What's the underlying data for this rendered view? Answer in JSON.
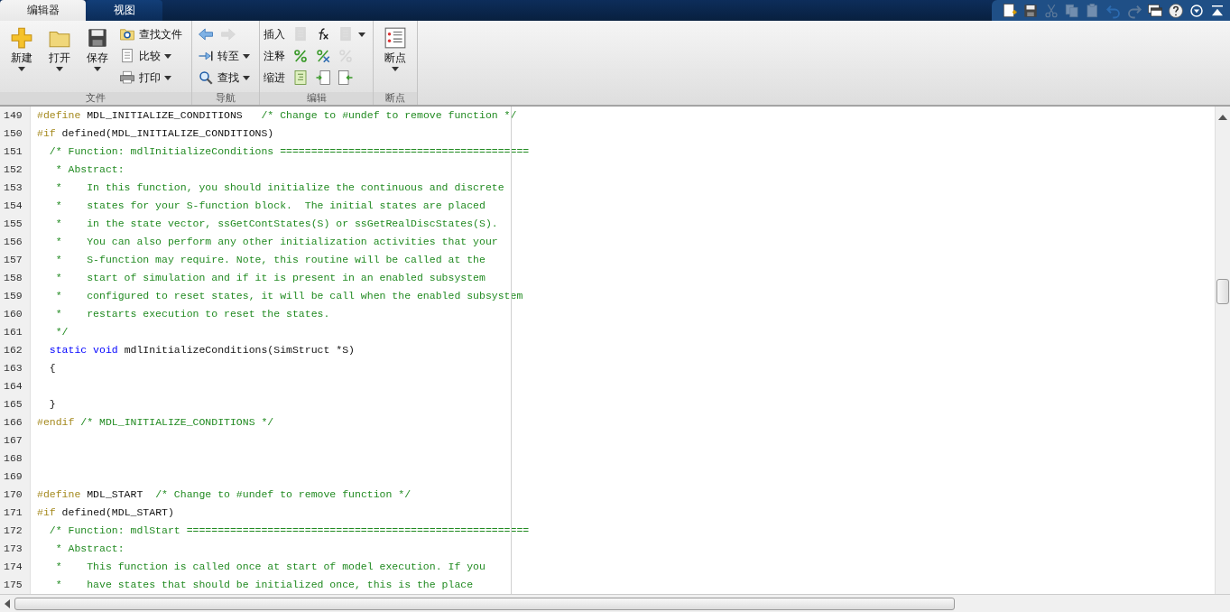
{
  "tabs": [
    {
      "label": "编辑器",
      "selected": true
    },
    {
      "label": "视图",
      "selected": false
    }
  ],
  "quick_access": [
    {
      "disabled": false
    },
    {
      "disabled": false
    },
    {
      "disabled": true
    },
    {
      "disabled": true
    },
    {
      "disabled": true
    },
    {
      "disabled": false
    },
    {
      "disabled": true
    },
    {
      "disabled": false
    },
    {
      "disabled": false
    },
    {
      "disabled": false
    },
    {
      "disabled": false
    }
  ],
  "ribbon": {
    "groups": [
      {
        "label": "文件",
        "columns": [
          {
            "kind": "large",
            "label": "新建",
            "menu": true
          },
          {
            "kind": "large",
            "label": "打开",
            "menu": true
          },
          {
            "kind": "large",
            "label": "保存",
            "menu": true
          },
          {
            "kind": "stack",
            "rows": [
              {
                "kind": "labeled",
                "label": "查找文件",
                "icons": [
                  {
                    "disabled": false
                  }
                ],
                "menu": false
              },
              {
                "kind": "labeled",
                "label": "比较",
                "icons": [
                  {
                    "disabled": false
                  }
                ],
                "menu": true
              },
              {
                "kind": "labeled",
                "label": "打印",
                "icons": [
                  {
                    "disabled": false
                  }
                ],
                "menu": true
              }
            ]
          }
        ]
      },
      {
        "label": "导航",
        "columns": [
          {
            "kind": "stack",
            "rows": [
              {
                "kind": "tools",
                "icons": [
                  {
                    "disabled": false
                  },
                  {
                    "disabled": true
                  }
                ],
                "menu": false
              },
              {
                "kind": "labeled",
                "label": "转至",
                "icons": [
                  {
                    "disabled": false
                  }
                ],
                "menu": true
              },
              {
                "kind": "labeled",
                "label": "查找",
                "icons": [
                  {
                    "disabled": false
                  }
                ],
                "menu": true
              }
            ]
          }
        ]
      },
      {
        "label": "编辑",
        "columns": [
          {
            "kind": "stack",
            "rows": [
              {
                "kind": "tools",
                "label": "插入",
                "icons": [
                  {
                    "disabled": true
                  },
                  {
                    "disabled": false
                  },
                  {
                    "disabled": true
                  }
                ],
                "menu": true
              },
              {
                "kind": "tools",
                "label": "注释",
                "icons": [
                  {
                    "disabled": false
                  },
                  {
                    "disabled": false
                  },
                  {
                    "disabled": true
                  }
                ],
                "menu": false
              },
              {
                "kind": "tools",
                "label": "缩进",
                "icons": [
                  {
                    "disabled": false
                  },
                  {
                    "disabled": false
                  },
                  {
                    "disabled": false
                  }
                ],
                "menu": false
              }
            ]
          }
        ]
      },
      {
        "label": "断点",
        "columns": [
          {
            "kind": "large",
            "label": "断点",
            "menu": true
          }
        ]
      }
    ]
  },
  "editor": {
    "lines": [
      {
        "number": "149",
        "tokens": [
          {
            "kind": "preproc",
            "text": "#define"
          },
          {
            "kind": "plain",
            "text": " MDL_INITIALIZE_CONDITIONS   "
          },
          {
            "kind": "comment",
            "text": "/* Change to #undef to remove function */"
          }
        ]
      },
      {
        "number": "150",
        "tokens": [
          {
            "kind": "preproc",
            "text": "#if"
          },
          {
            "kind": "plain",
            "text": " defined(MDL_INITIALIZE_CONDITIONS)"
          }
        ]
      },
      {
        "number": "151",
        "tokens": [
          {
            "kind": "comment",
            "text": "  /* Function: mdlInitializeConditions ========================================"
          }
        ]
      },
      {
        "number": "152",
        "tokens": [
          {
            "kind": "comment",
            "text": "   * Abstract:"
          }
        ]
      },
      {
        "number": "153",
        "tokens": [
          {
            "kind": "comment",
            "text": "   *    In this function, you should initialize the continuous and discrete"
          }
        ]
      },
      {
        "number": "154",
        "tokens": [
          {
            "kind": "comment",
            "text": "   *    states for your S-function block.  The initial states are placed"
          }
        ]
      },
      {
        "number": "155",
        "tokens": [
          {
            "kind": "comment",
            "text": "   *    in the state vector, ssGetContStates(S) or ssGetRealDiscStates(S)."
          }
        ]
      },
      {
        "number": "156",
        "tokens": [
          {
            "kind": "comment",
            "text": "   *    You can also perform any other initialization activities that your"
          }
        ]
      },
      {
        "number": "157",
        "tokens": [
          {
            "kind": "comment",
            "text": "   *    S-function may require. Note, this routine will be called at the"
          }
        ]
      },
      {
        "number": "158",
        "tokens": [
          {
            "kind": "comment",
            "text": "   *    start of simulation and if it is present in an enabled subsystem"
          }
        ]
      },
      {
        "number": "159",
        "tokens": [
          {
            "kind": "comment",
            "text": "   *    configured to reset states, it will be call when the enabled subsystem"
          }
        ]
      },
      {
        "number": "160",
        "tokens": [
          {
            "kind": "comment",
            "text": "   *    restarts execution to reset the states."
          }
        ]
      },
      {
        "number": "161",
        "tokens": [
          {
            "kind": "comment",
            "text": "   */"
          }
        ]
      },
      {
        "number": "162",
        "tokens": [
          {
            "kind": "keyword",
            "text": "  static"
          },
          {
            "kind": "keyword",
            "text": " void"
          },
          {
            "kind": "plain",
            "text": " mdlInitializeConditions(SimStruct *S)"
          }
        ]
      },
      {
        "number": "163",
        "tokens": [
          {
            "kind": "plain",
            "text": "  {"
          }
        ]
      },
      {
        "number": "164"
      },
      {
        "number": "165",
        "tokens": [
          {
            "kind": "plain",
            "text": "  }"
          }
        ]
      },
      {
        "number": "166",
        "tokens": [
          {
            "kind": "preproc",
            "text": "#endif"
          },
          {
            "kind": "comment",
            "text": " /* MDL_INITIALIZE_CONDITIONS */"
          }
        ]
      },
      {
        "number": "167"
      },
      {
        "number": "168"
      },
      {
        "number": "169"
      },
      {
        "number": "170",
        "tokens": [
          {
            "kind": "preproc",
            "text": "#define"
          },
          {
            "kind": "plain",
            "text": " MDL_START  "
          },
          {
            "kind": "comment",
            "text": "/* Change to #undef to remove function */"
          }
        ]
      },
      {
        "number": "171",
        "tokens": [
          {
            "kind": "preproc",
            "text": "#if"
          },
          {
            "kind": "plain",
            "text": " defined(MDL_START)"
          }
        ]
      },
      {
        "number": "172",
        "tokens": [
          {
            "kind": "comment",
            "text": "  /* Function: mdlStart ======================================================="
          }
        ]
      },
      {
        "number": "173",
        "tokens": [
          {
            "kind": "comment",
            "text": "   * Abstract:"
          }
        ]
      },
      {
        "number": "174",
        "tokens": [
          {
            "kind": "comment",
            "text": "   *    This function is called once at start of model execution. If you"
          }
        ]
      },
      {
        "number": "175",
        "tokens": [
          {
            "kind": "comment",
            "text": "   *    have states that should be initialized once, this is the place"
          }
        ]
      }
    ]
  }
}
